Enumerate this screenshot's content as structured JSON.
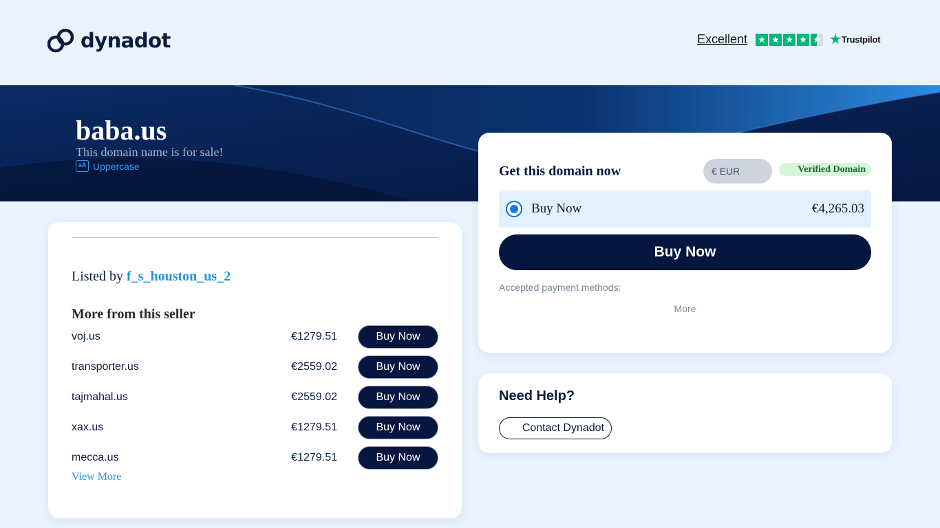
{
  "header": {
    "logo_text": "dynadot",
    "trust_rating": "Excellent",
    "trust_brand": "Trustpilot",
    "trust_stars": 4.5
  },
  "domain": {
    "name": "baba.us",
    "subtitle": "This domain name is for sale!",
    "uppercase_label": "Uppercase",
    "uppercase_icon_text": "aA"
  },
  "seller": {
    "listed_by_prefix": "Listed by",
    "name": "f_s_houston_us_2",
    "more_title": "More from this seller",
    "items": [
      {
        "name": "voj.us",
        "price": "€1279.51",
        "button": "Buy Now"
      },
      {
        "name": "transporter.us",
        "price": "€2559.02",
        "button": "Buy Now"
      },
      {
        "name": "tajmahal.us",
        "price": "€2559.02",
        "button": "Buy Now"
      },
      {
        "name": "xax.us",
        "price": "€1279.51",
        "button": "Buy Now"
      },
      {
        "name": "mecca.us",
        "price": "€1279.51",
        "button": "Buy Now"
      }
    ],
    "view_more": "View More"
  },
  "purchase": {
    "title": "Get this domain now",
    "currency": "€ EUR",
    "verified": "Verified Domain",
    "option_label": "Buy Now",
    "option_price": "€4,265.03",
    "buy_button": "Buy Now",
    "payments_label": "Accepted payment methods:",
    "more_label": "More"
  },
  "help": {
    "title": "Need Help?",
    "contact_button": "Contact Dynadot"
  },
  "colors": {
    "navy": "#06163f",
    "accent_blue": "#1e96d8",
    "trustpilot_green": "#00b67a",
    "page_bg": "#eaf2fd"
  }
}
